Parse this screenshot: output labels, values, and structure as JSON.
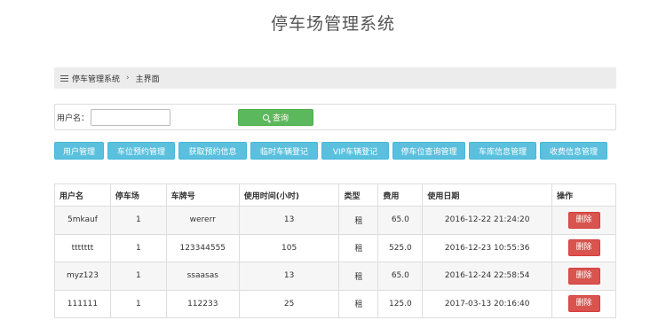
{
  "page": {
    "title": "停车场管理系统"
  },
  "breadcrumb": {
    "system": "停车管理系统",
    "separator": "›",
    "current": "主界面"
  },
  "search": {
    "label": "用户名：",
    "value": "",
    "placeholder": "",
    "button": "查询"
  },
  "nav": [
    "用户管理",
    "车位预约管理",
    "获取预约信息",
    "临时车辆登记",
    "VIP车辆登记",
    "停车位查询管理",
    "车库信息管理",
    "收费信息管理"
  ],
  "table": {
    "headers": [
      "用户名",
      "停车场",
      "车牌号",
      "使用时间(小时)",
      "类型",
      "费用",
      "使用日期",
      "操作"
    ],
    "rows": [
      {
        "user": "5mkauf",
        "lot": "1",
        "plate": "wererr",
        "hours": "13",
        "type": "租",
        "fee": "65.0",
        "date": "2016-12-22 21:24:20",
        "action": "删除"
      },
      {
        "user": "ttttttt",
        "lot": "1",
        "plate": "123344555",
        "hours": "105",
        "type": "租",
        "fee": "525.0",
        "date": "2016-12-23 10:55:36",
        "action": "删除"
      },
      {
        "user": "myz123",
        "lot": "1",
        "plate": "ssaasas",
        "hours": "13",
        "type": "租",
        "fee": "65.0",
        "date": "2016-12-24 22:58:54",
        "action": "删除"
      },
      {
        "user": "111111",
        "lot": "1",
        "plate": "112233",
        "hours": "25",
        "type": "租",
        "fee": "125.0",
        "date": "2017-03-13 20:16:40",
        "action": "删除"
      }
    ]
  },
  "colors": {
    "nav": "#5bc0de",
    "query": "#5cb85c",
    "delete": "#d9534f"
  }
}
